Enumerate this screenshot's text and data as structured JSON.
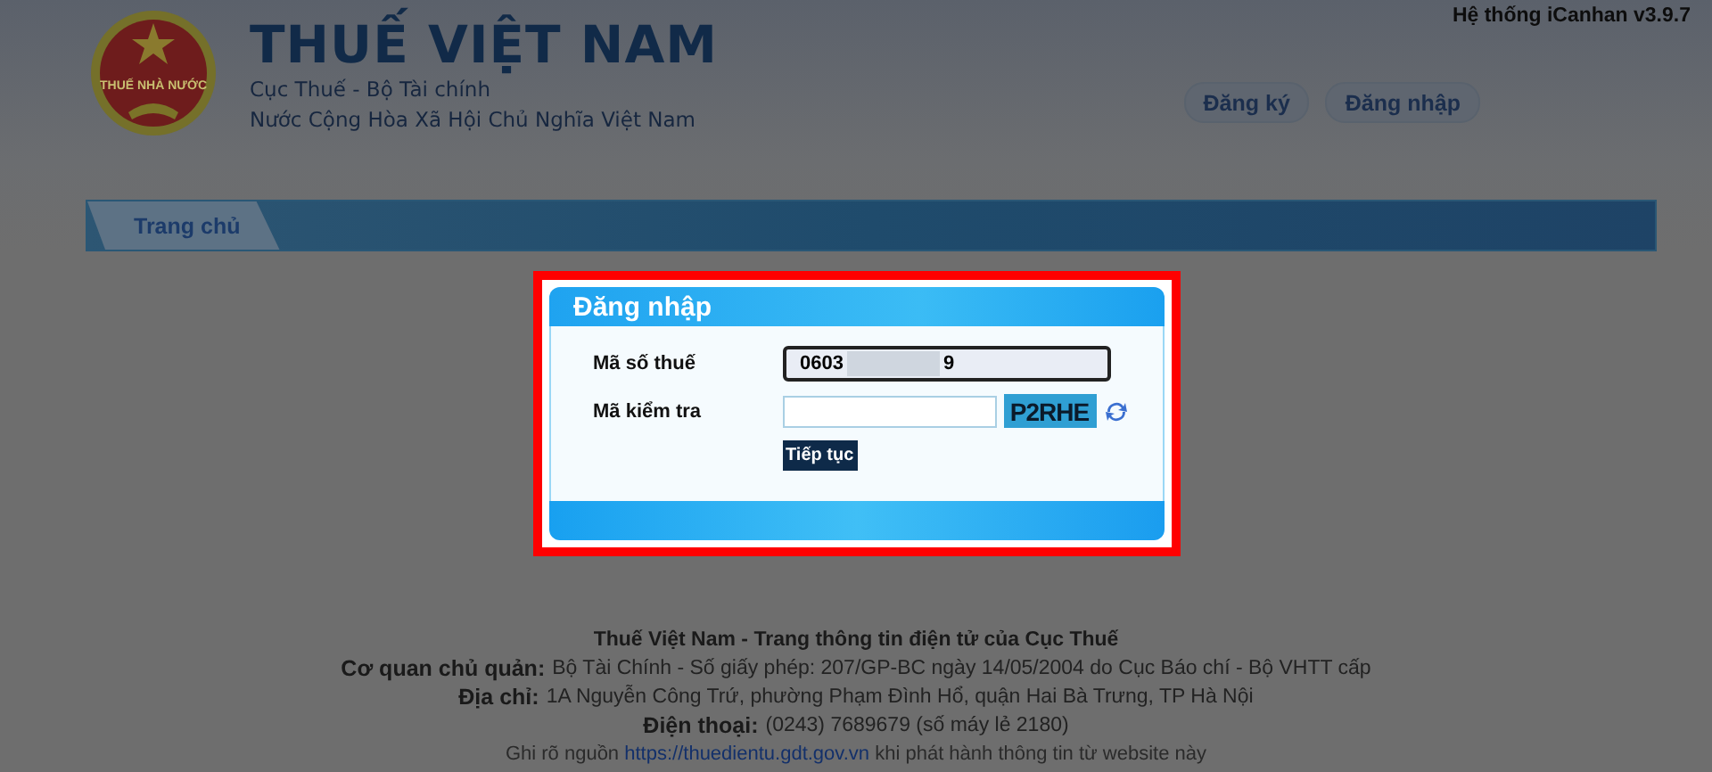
{
  "header": {
    "title": "THUẾ VIỆT NAM",
    "subtitle_lines": [
      "Cục Thuế - Bộ Tài chính",
      "Nước Cộng Hòa Xã Hội Chủ Nghĩa Việt Nam"
    ],
    "logo_text": "THUẾ NHÀ NƯỚC",
    "version": "Hệ thống iCanhan v3.9.7",
    "buttons": [
      "Đăng ký",
      "Đăng nhập"
    ]
  },
  "nav": {
    "tabs": [
      {
        "label": "Trang chủ",
        "selected": true
      }
    ]
  },
  "login_dialog": {
    "title": "Đăng nhập",
    "fields": [
      {
        "kind": "masked",
        "label": "Mã số thuế",
        "value_start": "0603",
        "value_end": "9"
      },
      {
        "kind": "captcha",
        "label": "Mã kiểm tra",
        "captcha": "P2RHE"
      }
    ],
    "submit": "Tiếp tục"
  },
  "footer": {
    "title": "Thuế Việt Nam - Trang thông tin điện tử của Cục Thuế",
    "lines": [
      {
        "label": "Cơ quan chủ quản:",
        "text": "Bộ Tài Chính - Số giấy phép: 207/GP-BC ngày 14/05/2004 do Cục Báo chí - Bộ VHTT cấp"
      },
      {
        "label": "Địa chỉ:",
        "text": "1A Nguyễn Công Trứ, phường Phạm Đình Hổ, quận Hai Bà Trưng, TP Hà Nội"
      },
      {
        "label": "Điện thoại:",
        "text": "(0243) 7689679 (số máy lẻ 2180)"
      }
    ],
    "source": {
      "before": "Ghi rõ nguồn",
      "link": "https://thuedientu.gdt.gov.vn",
      "after": "khi phát hành thông tin từ website này"
    }
  }
}
